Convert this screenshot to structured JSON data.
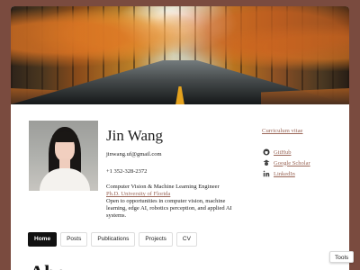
{
  "profile": {
    "name": "Jin Wang",
    "email": "jinwang.uf@gmail.com",
    "phone": "+1 352-328-2372",
    "role": "Computer Vision & Machine Learning Engineer",
    "education": "Ph.D. University of Florida",
    "bio_lines": [
      "Open to opportunities in computer vision, machine",
      "learning, edge AI, robotics perception, and applied AI",
      "systems."
    ]
  },
  "links": {
    "curriculum_vitae": "Curriculum vitae",
    "social": [
      {
        "label": "GitHub",
        "icon": "github-icon"
      },
      {
        "label": "Google Scholar",
        "icon": "google-scholar-icon"
      },
      {
        "label": "LinkedIn",
        "icon": "linkedin-icon"
      }
    ]
  },
  "nav": {
    "tabs": [
      {
        "label": "Home",
        "active": true
      },
      {
        "label": "Posts",
        "active": false
      },
      {
        "label": "Publications",
        "active": false
      },
      {
        "label": "Projects",
        "active": false
      },
      {
        "label": "CV",
        "active": false
      }
    ]
  },
  "section": {
    "heading": "Abo"
  },
  "tools": {
    "label": "Tools"
  },
  "colors": {
    "background": "#7a4b3f",
    "link": "#9a6657",
    "active_tab": "#111111"
  }
}
